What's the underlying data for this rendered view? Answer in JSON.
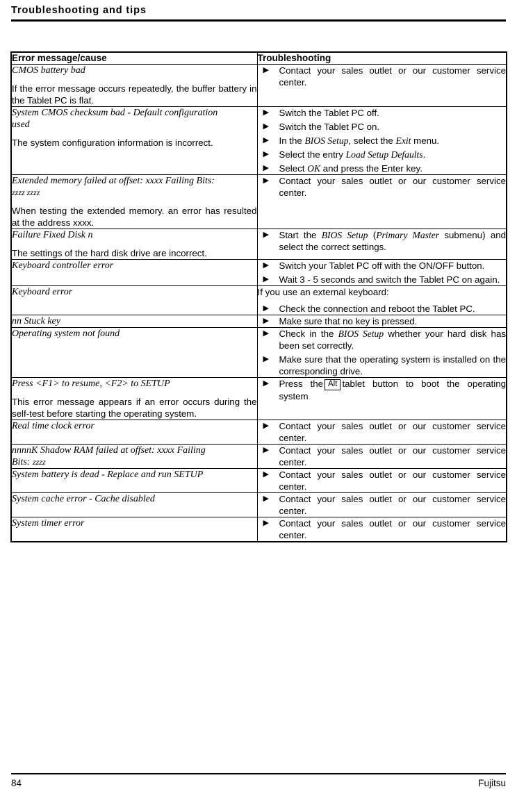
{
  "header": {
    "title": "Troubleshooting and tips"
  },
  "table": {
    "columns": {
      "cause": "Error message/cause",
      "fix": "Troubleshooting"
    },
    "rows": [
      {
        "message": "CMOS battery bad",
        "description": "If the error message occurs repeatedly, the buffer battery in the Tablet PC is flat.",
        "lead_in": "",
        "steps": [
          "Contact your sales outlet or our customer service center."
        ]
      },
      {
        "message": "System CMOS checksum bad - Default configuration used",
        "description": "The system configuration information is incorrect.",
        "lead_in": "",
        "steps": [
          "Switch the Tablet PC off.",
          "Switch the Tablet PC on.",
          "In the BIOS Setup, select the Exit menu.",
          "Select the entry Load Setup Defaults.",
          "Select OK and press the Enter key."
        ]
      },
      {
        "message": "Extended memory failed at offset: xxxx Failing Bits: zzzz zzzz",
        "description": "When testing the extended memory. an error has resulted at the address xxxx.",
        "lead_in": "",
        "steps": [
          "Contact your sales outlet or our customer service center."
        ]
      },
      {
        "message": "Failure Fixed Disk n",
        "description": "The settings of the hard disk drive are incorrect.",
        "lead_in": "",
        "steps": [
          "Start the BIOS Setup (Primary Master submenu) and select the correct settings."
        ]
      },
      {
        "message": "Keyboard controller error",
        "description": "",
        "lead_in": "",
        "steps": [
          "Switch your Tablet PC off with the ON/OFF button.",
          "Wait 3 - 5 seconds and switch the Tablet PC on again."
        ]
      },
      {
        "message": "Keyboard error",
        "description": "",
        "lead_in": "If you use an external keyboard:",
        "steps": [
          "Check the connection and reboot the Tablet PC."
        ]
      },
      {
        "message": "nn Stuck key",
        "description": "",
        "lead_in": "",
        "steps": [
          "Make sure that no key is pressed."
        ]
      },
      {
        "message": "Operating system not found",
        "description": "",
        "lead_in": "",
        "steps": [
          "Check in the BIOS Setup whether your hard disk has been set correctly.",
          "Make sure that the operating system is installed on the corresponding drive."
        ]
      },
      {
        "message": "Press <F1> to resume, <F2> to SETUP",
        "description": "This error message appears if an error occurs during the self-test before starting the operating system.",
        "lead_in": "",
        "steps": [
          "Press the Alt tablet button to boot the operating system"
        ],
        "keycap": "Alt"
      },
      {
        "message": "Real time clock error",
        "description": "",
        "lead_in": "",
        "steps": [
          "Contact your sales outlet or our customer service center."
        ]
      },
      {
        "message": "nnnnK Shadow RAM failed at offset: xxxx Failing Bits: zzzz",
        "description": "",
        "lead_in": "",
        "steps": [
          "Contact your sales outlet or our customer service center."
        ]
      },
      {
        "message": "System battery is dead - Replace and run SETUP",
        "description": "",
        "lead_in": "",
        "steps": [
          "Contact your sales outlet or our customer service center."
        ]
      },
      {
        "message": "System cache error - Cache disabled",
        "description": "",
        "lead_in": "",
        "steps": [
          "Contact your sales outlet or our customer service center."
        ]
      },
      {
        "message": "System timer error",
        "description": "",
        "lead_in": "",
        "steps": [
          "Contact your sales outlet or our customer service center."
        ]
      }
    ]
  },
  "row_text": {
    "r1": {
      "msg": "CMOS battery bad",
      "desc": "If the error message occurs repeatedly, the buffer battery in the Tablet PC is flat.",
      "s1": "Contact your sales outlet or our customer service center."
    },
    "r2": {
      "msg_a": "System CMOS checksum bad - Default configuration",
      "msg_b": "used",
      "desc": "The system configuration information is incorrect.",
      "s1": "Switch the Tablet PC off.",
      "s2": "Switch the Tablet PC on.",
      "s3_a": "In the ",
      "s3_b": "BIOS Setup",
      "s3_c": ", select the ",
      "s3_d": "Exit",
      "s3_e": " menu.",
      "s4_a": "Select the entry ",
      "s4_b": "Load Setup Defaults",
      "s4_c": ".",
      "s5_a": "Select ",
      "s5_b": "OK",
      "s5_c": " and press the Enter key."
    },
    "r3": {
      "msg_a": "Extended memory failed at offset: xxxx Failing Bits:",
      "msg_b": "zzzz zzzz",
      "desc": "When testing the extended memory. an error has resulted at the address xxxx.",
      "s1": "Contact your sales outlet or our customer service center."
    },
    "r4": {
      "msg": "Failure Fixed Disk n",
      "desc": "The settings of the hard disk drive are incorrect.",
      "s1_a": "Start the ",
      "s1_b": "BIOS Setup",
      "s1_c": " (",
      "s1_d": "Primary Master",
      "s1_e": " submenu) and select the correct settings."
    },
    "r5": {
      "msg": "Keyboard controller error",
      "s1": "Switch your Tablet PC off with the ON/OFF button.",
      "s2": "Wait 3 - 5 seconds and switch the Tablet PC on again."
    },
    "r6": {
      "msg": "Keyboard error",
      "lead": "If you use an external keyboard:",
      "s1": "Check the connection and reboot the Tablet PC."
    },
    "r7": {
      "msg": "nn Stuck key",
      "s1": "Make sure that no key is pressed."
    },
    "r8": {
      "msg": "Operating system not found",
      "s1_a": "Check in the ",
      "s1_b": "BIOS Setup",
      "s1_c": " whether your hard disk has been set correctly.",
      "s2": "Make sure that the operating system is installed on the corresponding drive."
    },
    "r9": {
      "msg": "Press <F1> to resume, <F2> to SETUP",
      "desc": "This error message appears if an error occurs during the self-test before starting the operating system.",
      "s1_a": "Press the",
      "s1_key": "Alt",
      "s1_b": "tablet button to boot the operating system"
    },
    "r10": {
      "msg": "Real time clock error",
      "s1": "Contact your sales outlet or our customer service center."
    },
    "r11": {
      "msg_a": "nnnnK Shadow RAM failed at offset: xxxx Failing",
      "msg_b": "Bits: ",
      "msg_c": "zzzz",
      "s1": "Contact your sales outlet or our customer service center."
    },
    "r12": {
      "msg": "System battery is dead - Replace and run SETUP",
      "s1": "Contact your sales outlet or our customer service center."
    },
    "r13": {
      "msg": "System cache error - Cache disabled",
      "s1": "Contact your sales outlet or our customer service center."
    },
    "r14": {
      "msg": "System timer error",
      "s1": "Contact your sales outlet or our customer service center."
    }
  },
  "icons": {
    "bullet": "▶"
  },
  "footer": {
    "page_number": "84",
    "brand": "Fujitsu"
  }
}
